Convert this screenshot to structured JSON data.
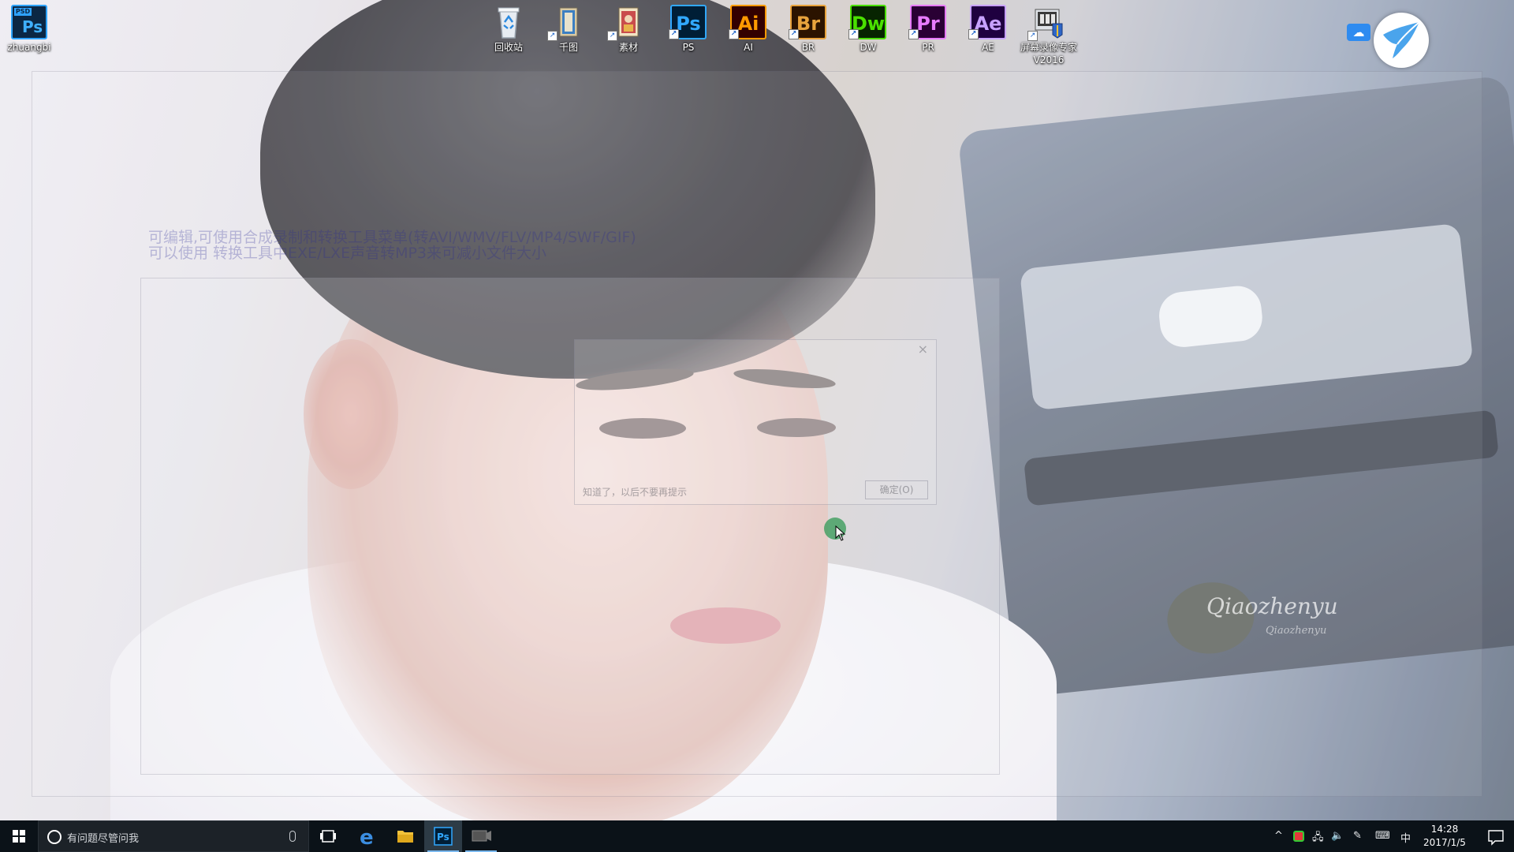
{
  "desktop": {
    "icons": [
      {
        "label": "zhuangbi",
        "icon": "psd-file-icon"
      },
      {
        "label": "回收站",
        "icon": "recycle-bin-icon"
      },
      {
        "label": "千图",
        "icon": "qiantu-shortcut-icon"
      },
      {
        "label": "素材",
        "icon": "materials-folder-icon"
      },
      {
        "label": "PS",
        "icon": "photoshop-icon",
        "abbr": "Ps",
        "color": "#31a8ff",
        "bg": "#001e36"
      },
      {
        "label": "AI",
        "icon": "illustrator-icon",
        "abbr": "Ai",
        "color": "#ff9a00",
        "bg": "#330000"
      },
      {
        "label": "BR",
        "icon": "bridge-icon",
        "abbr": "Br",
        "color": "#e8a33d",
        "bg": "#2b1300"
      },
      {
        "label": "DW",
        "icon": "dreamweaver-icon",
        "abbr": "Dw",
        "color": "#4ae000",
        "bg": "#072401"
      },
      {
        "label": "PR",
        "icon": "premiere-icon",
        "abbr": "Pr",
        "color": "#e77bff",
        "bg": "#2a0034"
      },
      {
        "label": "AE",
        "icon": "after-effects-icon",
        "abbr": "Ae",
        "color": "#c7a1ff",
        "bg": "#1f0040"
      },
      {
        "label": "屏幕录像专家\nV2016",
        "icon": "screen-recorder-icon"
      }
    ],
    "psd_badge": "PSD",
    "ps_abbr": "Ps"
  },
  "ghost": {
    "line1": "可编辑,可使用合成录制和转换工具菜单(转AVI/WMV/FLV/MP4/SWF/GIF)",
    "line2": "可以使用 转换工具中EXE/LXE声音转MP3来可减小文件大小",
    "dialog_check": "知道了，以后不要再提示",
    "dialog_ok": "确定(O)"
  },
  "wallpaper": {
    "watermark": "Qiaozhenyu",
    "watermark_sub": "Qiaozhenyu"
  },
  "taskbar": {
    "search_placeholder": "有问题尽管问我",
    "clock_time": "14:28",
    "clock_date": "2017/1/5",
    "ime_label": "中",
    "accent_color": "#7ab8ee"
  }
}
